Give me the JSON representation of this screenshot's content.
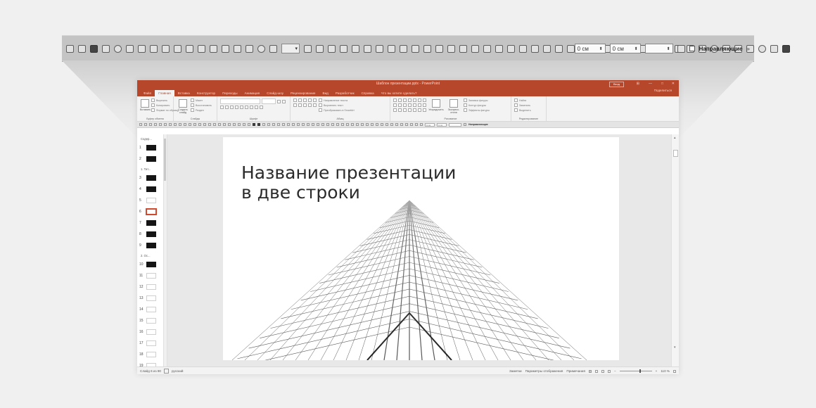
{
  "toolbar_strip": {
    "font_size_value": "",
    "field_1_value": "0 см",
    "field_2_value": "0 см",
    "field_3_value": "",
    "guides_label": "Направляющие",
    "overflow": "»"
  },
  "window": {
    "title": "Шаблон презентации.pptx  -  PowerPoint",
    "signin": "Вход",
    "controls": [
      "⊞",
      "—",
      "□",
      "✕"
    ],
    "share": "Поделиться",
    "tabs": [
      "Файл",
      "Главная",
      "Вставка",
      "Конструктор",
      "Переходы",
      "Анимация",
      "Слайд-шоу",
      "Рецензирование",
      "Вид",
      "Разработчик",
      "Справка",
      "Что вы хотите сделать?"
    ],
    "active_tab": "Главная"
  },
  "ribbon": {
    "clipboard": {
      "label": "Буфер обмена",
      "paste": "Вставить",
      "items": [
        "Вырезать",
        "Копировать",
        "Формат по образцу"
      ]
    },
    "slides": {
      "label": "Слайды",
      "new_slide": "Создать слайд",
      "items": [
        "Макет",
        "Восстановить",
        "Раздел"
      ]
    },
    "font": {
      "label": "Шрифт"
    },
    "paragraph": {
      "label": "Абзац",
      "items": [
        "Направление текста",
        "Выровнять текст",
        "Преобразовать в SmartArt"
      ]
    },
    "drawing": {
      "label": "Рисование",
      "arrange": "Упорядочить",
      "quick_styles": "Экспресс-стили",
      "items": [
        "Заливка фигуры",
        "Контур фигуры",
        "Эффекты фигуры"
      ]
    },
    "editing": {
      "label": "Редактирование",
      "items": [
        "Найти",
        "Заменить",
        "Выделить"
      ]
    }
  },
  "qat": {
    "field_1": "0 см",
    "field_2": "0 см",
    "guides_label": "Направляющие"
  },
  "thumbnails": {
    "sections": [
      {
        "label": "Содер...",
        "slides": [
          {
            "n": "1",
            "style": "dark"
          },
          {
            "n": "2",
            "style": "dark"
          }
        ]
      },
      {
        "label": "1. Тит...",
        "slides": [
          {
            "n": "3",
            "style": "dark"
          },
          {
            "n": "4",
            "style": "dark"
          },
          {
            "n": "5",
            "style": "light"
          },
          {
            "n": "6",
            "style": "selected"
          },
          {
            "n": "7",
            "style": "dark"
          },
          {
            "n": "8",
            "style": "dark"
          },
          {
            "n": "9",
            "style": "dark"
          }
        ]
      },
      {
        "label": "2. Ос...",
        "slides": [
          {
            "n": "10",
            "style": "dark"
          },
          {
            "n": "11",
            "style": "light"
          },
          {
            "n": "12",
            "style": "light"
          },
          {
            "n": "13",
            "style": "light"
          },
          {
            "n": "14",
            "style": "light"
          },
          {
            "n": "15",
            "style": "light"
          },
          {
            "n": "16",
            "style": "light"
          },
          {
            "n": "17",
            "style": "light"
          },
          {
            "n": "18",
            "style": "light"
          },
          {
            "n": "19",
            "style": "light"
          }
        ]
      }
    ]
  },
  "slide": {
    "title": "Название презентации\nв две строки"
  },
  "status": {
    "slide_of": "Слайд 6 из 90",
    "language": "русский",
    "notes": "Заметки",
    "display_settings": "Параметры отображения",
    "comments": "Примечания",
    "zoom": "110 %"
  },
  "colors": {
    "accent": "#b7472a",
    "ribbon_bg": "#f3f3f3",
    "editor_bg": "#e8e8e8"
  }
}
